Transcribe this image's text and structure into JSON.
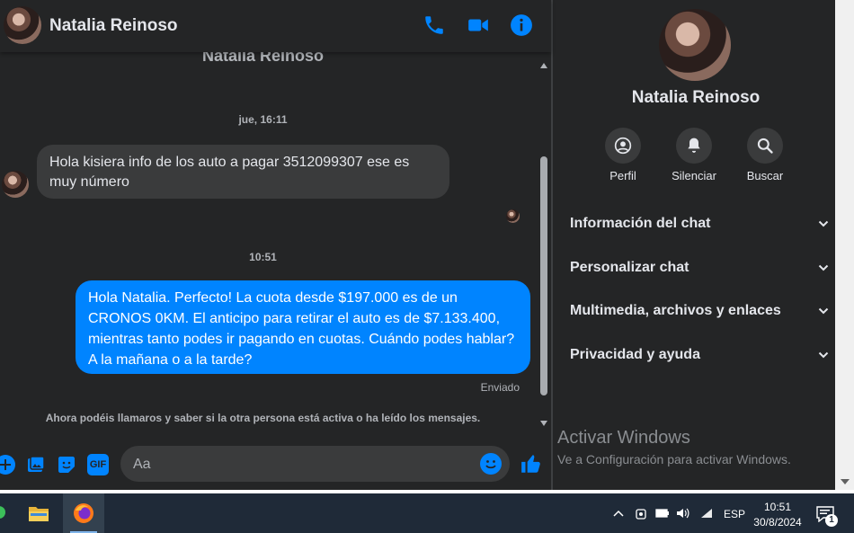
{
  "header": {
    "name": "Natalia Reinoso"
  },
  "conversation": {
    "partial_name": "Natalia Reinoso",
    "time_1": "jue, 16:11",
    "incoming_text": "Hola kisiera info de los auto a pagar 3512099307  ese es muy número",
    "time_2": "10:51",
    "outgoing_text": "Hola Natalia. Perfecto! La cuota desde $197.000 es de un CRONOS 0KM. El anticipo para retirar el auto es de $7.133.400, mientras tanto podes ir pagando en cuotas. Cuándo podes hablar? A la mañana o a la tarde?",
    "status": "Enviado",
    "notice": "Ahora podéis llamaros y saber si la otra persona está activa o ha leído los mensajes."
  },
  "composer": {
    "placeholder": "Aa",
    "gif_label": "GIF"
  },
  "sidebar": {
    "name": "Natalia Reinoso",
    "actions": [
      {
        "label": "Perfil",
        "icon": "profile-icon"
      },
      {
        "label": "Silenciar",
        "icon": "bell-icon"
      },
      {
        "label": "Buscar",
        "icon": "search-icon"
      }
    ],
    "sections": [
      {
        "label": "Información del chat"
      },
      {
        "label": "Personalizar chat"
      },
      {
        "label": "Multimedia, archivos y enlaces"
      },
      {
        "label": "Privacidad y ayuda"
      }
    ]
  },
  "watermark": {
    "title": "Activar Windows",
    "subtitle": "Ve a Configuración para activar Windows."
  },
  "taskbar": {
    "language": "ESP",
    "time": "10:51",
    "date": "30/8/2024",
    "notification_count": "1"
  },
  "colors": {
    "accent": "#0084ff",
    "background": "#242526",
    "bubble_in": "#3a3b3c"
  }
}
